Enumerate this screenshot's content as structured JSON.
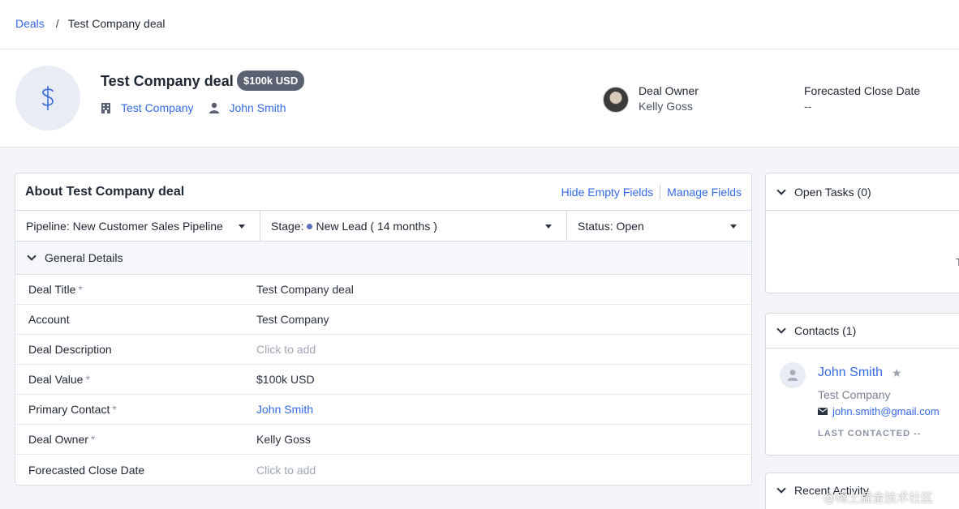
{
  "breadcrumb": {
    "parent": "Deals",
    "separator": "/",
    "current": "Test Company deal"
  },
  "header": {
    "title": "Test Company deal",
    "value_badge": "$100k USD",
    "account": "Test Company",
    "contact": "John Smith",
    "owner_label": "Deal Owner",
    "owner_value": "Kelly Goss",
    "close_label": "Forecasted Close Date",
    "close_value": "--"
  },
  "about": {
    "title": "About Test Company deal",
    "hide_empty": "Hide Empty Fields",
    "manage_fields": "Manage Fields",
    "pipeline_label": "Pipeline:",
    "pipeline_value": "New Customer Sales Pipeline",
    "stage_label": "Stage:",
    "stage_value": "New Lead ( 14 months )",
    "status_label": "Status:",
    "status_value": "Open",
    "section": "General Details",
    "rows": [
      {
        "label": "Deal Title",
        "required": "*",
        "value": "Test Company deal"
      },
      {
        "label": "Account",
        "required": "",
        "value": "Test Company"
      },
      {
        "label": "Deal Description",
        "required": "",
        "value": "Click to add"
      },
      {
        "label": "Deal Value",
        "required": "*",
        "value": "$100k USD"
      },
      {
        "label": "Primary Contact",
        "required": "*",
        "value": "John Smith"
      },
      {
        "label": "Deal Owner",
        "required": "*",
        "value": "Kelly Goss"
      },
      {
        "label": "Forecasted Close Date",
        "required": "",
        "value": "Click to add"
      }
    ]
  },
  "sidebar": {
    "tasks_title": "Open Tasks (0)",
    "tasks_edge_char": "T",
    "contacts_title": "Contacts (1)",
    "contact_name": "John Smith",
    "contact_star": "★",
    "contact_company": "Test Company",
    "contact_email": "john.smith@gmail.com",
    "contact_last": "LAST CONTACTED --",
    "activity_title": "Recent Activity"
  },
  "watermark": "@稀土掘金技术社区",
  "colors": {
    "link": "#356ae6",
    "badge": "#5a6272",
    "stage_dot": "#5a6fb8"
  }
}
